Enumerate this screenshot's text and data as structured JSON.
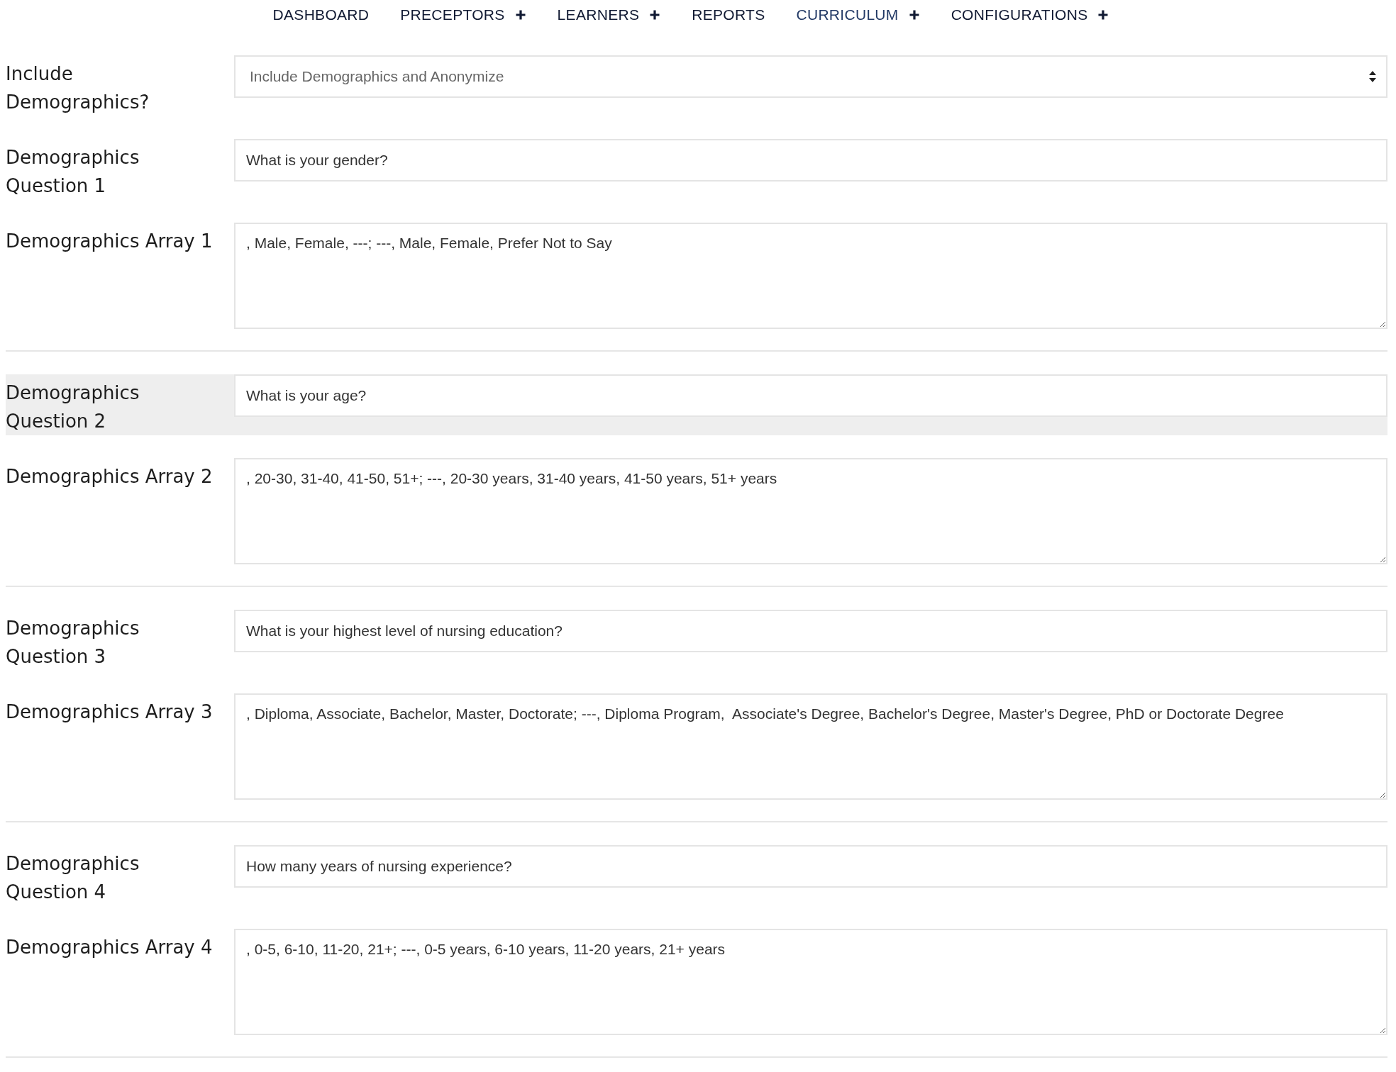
{
  "nav": [
    {
      "label": "DASHBOARD",
      "has_submenu": false,
      "selected": false
    },
    {
      "label": "PRECEPTORS",
      "has_submenu": true,
      "selected": false
    },
    {
      "label": "LEARNERS",
      "has_submenu": true,
      "selected": false
    },
    {
      "label": "REPORTS",
      "has_submenu": false,
      "selected": false
    },
    {
      "label": "CURRICULUM",
      "has_submenu": true,
      "selected": true
    },
    {
      "label": "CONFIGURATIONS",
      "has_submenu": true,
      "selected": false
    }
  ],
  "form": {
    "groups": [
      {
        "rows": [
          {
            "kind": "select",
            "label": "Include Demographics?",
            "value": "Include Demographics and Anonymize",
            "highlighted": false
          },
          {
            "kind": "input",
            "label": "Demographics Question 1",
            "value": "What is your gender?",
            "highlighted": false
          },
          {
            "kind": "textarea",
            "label": "Demographics Array 1",
            "value": ", Male, Female, ---; ---, Male, Female, Prefer Not to Say",
            "highlighted": false
          }
        ]
      },
      {
        "rows": [
          {
            "kind": "input",
            "label": "Demographics Question 2",
            "value": "What is your age?",
            "highlighted": true
          },
          {
            "kind": "textarea",
            "label": "Demographics Array 2",
            "value": ", 20-30, 31-40, 41-50, 51+; ---, 20-30 years, 31-40 years, 41-50 years, 51+ years",
            "highlighted": false
          }
        ]
      },
      {
        "rows": [
          {
            "kind": "input",
            "label": "Demographics Question 3",
            "value": "What is your highest level of nursing education?",
            "highlighted": false
          },
          {
            "kind": "textarea",
            "label": "Demographics Array 3",
            "value": ", Diploma, Associate, Bachelor, Master, Doctorate; ---, Diploma Program,  Associate's Degree, Bachelor's Degree, Master's Degree, PhD or Doctorate Degree",
            "highlighted": false
          }
        ]
      },
      {
        "rows": [
          {
            "kind": "input",
            "label": "Demographics Question 4",
            "value": "How many years of nursing experience?",
            "highlighted": false
          },
          {
            "kind": "textarea",
            "label": "Demographics Array 4",
            "value": ", 0-5, 6-10, 11-20, 21+; ---, 0-5 years, 6-10 years, 11-20 years, 21+ years",
            "highlighted": false
          }
        ]
      }
    ]
  }
}
